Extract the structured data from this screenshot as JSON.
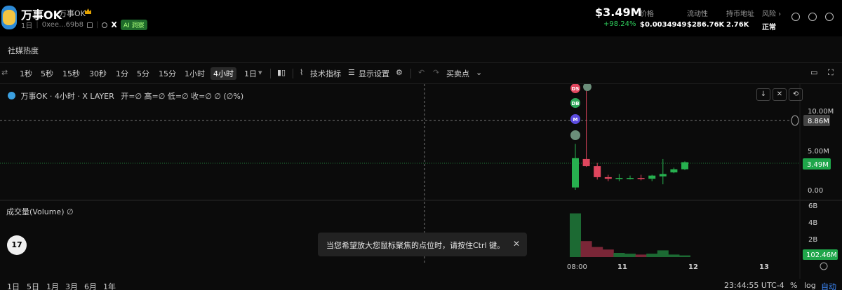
{
  "token": {
    "name": "万事OK",
    "symbol": "万事OK",
    "period": "1日",
    "address": "0xee...69b8",
    "ai_badge": "AI 洞察"
  },
  "price": {
    "main": "$3.49M",
    "change": "+98.24%"
  },
  "stats": [
    {
      "label": "价格",
      "value": "$0.0034949"
    },
    {
      "label": "流动性",
      "value": "$286.76K"
    },
    {
      "label": "持币地址",
      "value": "2.76K"
    },
    {
      "label": "风险 ›",
      "value": "正常"
    }
  ],
  "social_label": "社媒热度",
  "toolbar": {
    "intervals": [
      "1秒",
      "5秒",
      "15秒",
      "30秒",
      "1分",
      "5分",
      "15分",
      "1小时",
      "4小时",
      "1日"
    ],
    "active_interval": "4小时",
    "indicators": "技术指标",
    "display_settings": "显示设置",
    "buy_sell_points": "买卖点"
  },
  "legend": {
    "text": "万事OK · 4小时 · X LAYER",
    "ohlc": "开=∅  高=∅  低=∅  收=∅  ∅ (∅%)"
  },
  "volume_legend": "成交量(Volume)  ∅",
  "tooltip": "当您希望放大您鼠标聚焦的点位时，请按住Ctrl 键。",
  "tv_logo": "17",
  "crosshair_price_label": "8.86M",
  "current_price_label": "3.49M",
  "current_volume_label": "102.46M",
  "chart_data": {
    "type": "candlestick",
    "price_axis_ticks": [
      "10.00M",
      "5.00M",
      "0.00"
    ],
    "volume_axis_ticks": [
      "6B",
      "4B",
      "2B"
    ],
    "x_axis_ticks": [
      "08:00",
      "11",
      "12",
      "13"
    ],
    "markers": [
      "DS",
      "DB",
      "M"
    ],
    "candles": [
      {
        "open": 0.3,
        "high": 5.8,
        "low": 0.0,
        "close": 4.0,
        "volume": 5.2
      },
      {
        "open": 3.9,
        "high": 12.5,
        "low": 2.9,
        "close": 3.0,
        "volume": 1.9
      },
      {
        "open": 3.0,
        "high": 3.4,
        "low": 1.3,
        "close": 1.6,
        "volume": 1.2
      },
      {
        "open": 1.6,
        "high": 1.9,
        "low": 1.1,
        "close": 1.4,
        "volume": 0.9
      },
      {
        "open": 1.5,
        "high": 2.0,
        "low": 1.1,
        "close": 1.5,
        "volume": 0.5
      },
      {
        "open": 1.5,
        "high": 1.8,
        "low": 1.3,
        "close": 1.5,
        "volume": 0.4
      },
      {
        "open": 1.5,
        "high": 1.9,
        "low": 1.2,
        "close": 1.4,
        "volume": 0.3
      },
      {
        "open": 1.4,
        "high": 1.9,
        "low": 1.1,
        "close": 1.8,
        "volume": 0.4
      },
      {
        "open": 1.7,
        "high": 3.9,
        "low": 0.7,
        "close": 2.0,
        "volume": 0.8
      },
      {
        "open": 2.2,
        "high": 2.8,
        "low": 2.1,
        "close": 2.6,
        "volume": 0.3
      },
      {
        "open": 2.6,
        "high": 3.6,
        "low": 2.5,
        "close": 3.49,
        "volume": 0.2
      }
    ]
  },
  "bottom_bar": {
    "ranges": [
      "1日",
      "5日",
      "1月",
      "3月",
      "6月",
      "1年"
    ],
    "time": "23:44:55 UTC-4",
    "percent": "%",
    "log": "log",
    "auto": "自动"
  }
}
